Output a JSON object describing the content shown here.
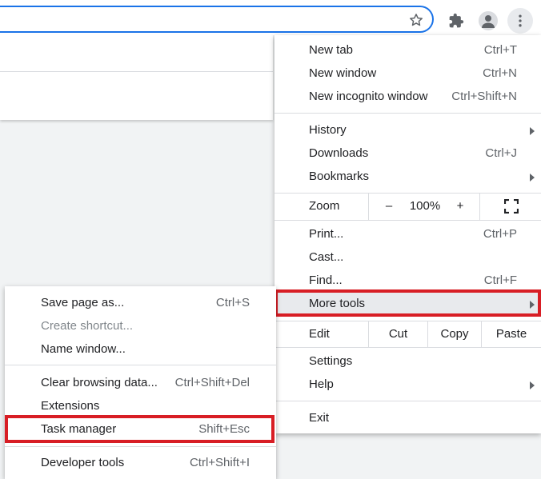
{
  "toolbar": {
    "icons": [
      "star-icon",
      "puzzle-extensions-icon",
      "profile-icon",
      "kebab-menu-icon"
    ],
    "colors": {
      "omnibox_border": "#1a73e8",
      "highlight": "#d81e25"
    }
  },
  "menu": {
    "new_tab": {
      "label": "New tab",
      "shortcut": "Ctrl+T"
    },
    "new_window": {
      "label": "New window",
      "shortcut": "Ctrl+N"
    },
    "new_incognito": {
      "label": "New incognito window",
      "shortcut": "Ctrl+Shift+N"
    },
    "history": {
      "label": "History"
    },
    "downloads": {
      "label": "Downloads",
      "shortcut": "Ctrl+J"
    },
    "bookmarks": {
      "label": "Bookmarks"
    },
    "zoom": {
      "label": "Zoom",
      "minus": "–",
      "value": "100%",
      "plus": "+"
    },
    "print": {
      "label": "Print...",
      "shortcut": "Ctrl+P"
    },
    "cast": {
      "label": "Cast..."
    },
    "find": {
      "label": "Find...",
      "shortcut": "Ctrl+F"
    },
    "more_tools": {
      "label": "More tools"
    },
    "edit": {
      "label": "Edit",
      "cut": "Cut",
      "copy": "Copy",
      "paste": "Paste"
    },
    "settings": {
      "label": "Settings"
    },
    "help": {
      "label": "Help"
    },
    "exit": {
      "label": "Exit"
    }
  },
  "submenu": {
    "save_page": {
      "label": "Save page as...",
      "shortcut": "Ctrl+S"
    },
    "create_shortcut": {
      "label": "Create shortcut..."
    },
    "name_window": {
      "label": "Name window..."
    },
    "clear_data": {
      "label": "Clear browsing data...",
      "shortcut": "Ctrl+Shift+Del"
    },
    "extensions": {
      "label": "Extensions"
    },
    "task_manager": {
      "label": "Task manager",
      "shortcut": "Shift+Esc"
    },
    "developer_tools": {
      "label": "Developer tools",
      "shortcut": "Ctrl+Shift+I"
    }
  }
}
